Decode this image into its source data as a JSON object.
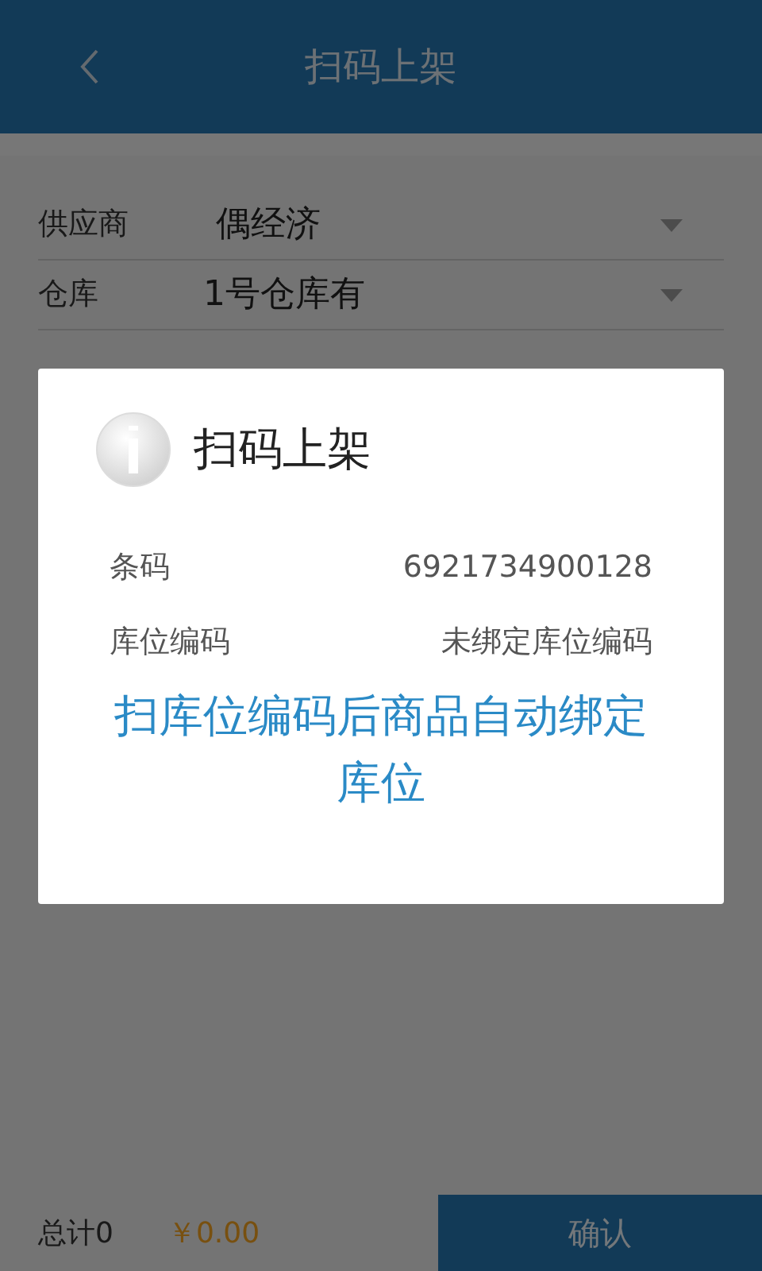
{
  "header": {
    "title": "扫码上架"
  },
  "form": [
    {
      "label": "供应商",
      "value": "偶经济"
    },
    {
      "label": "仓库",
      "value": "1号仓库有"
    }
  ],
  "dialog": {
    "title": "扫码上架",
    "rows": [
      {
        "label": "条码",
        "value": "6921734900128"
      },
      {
        "label": "库位编码",
        "value": "未绑定库位编码"
      }
    ],
    "message": "扫库位编码后商品自动绑定库位"
  },
  "footer": {
    "total": "总计0",
    "amount": "￥0.00",
    "confirm": "确认"
  }
}
